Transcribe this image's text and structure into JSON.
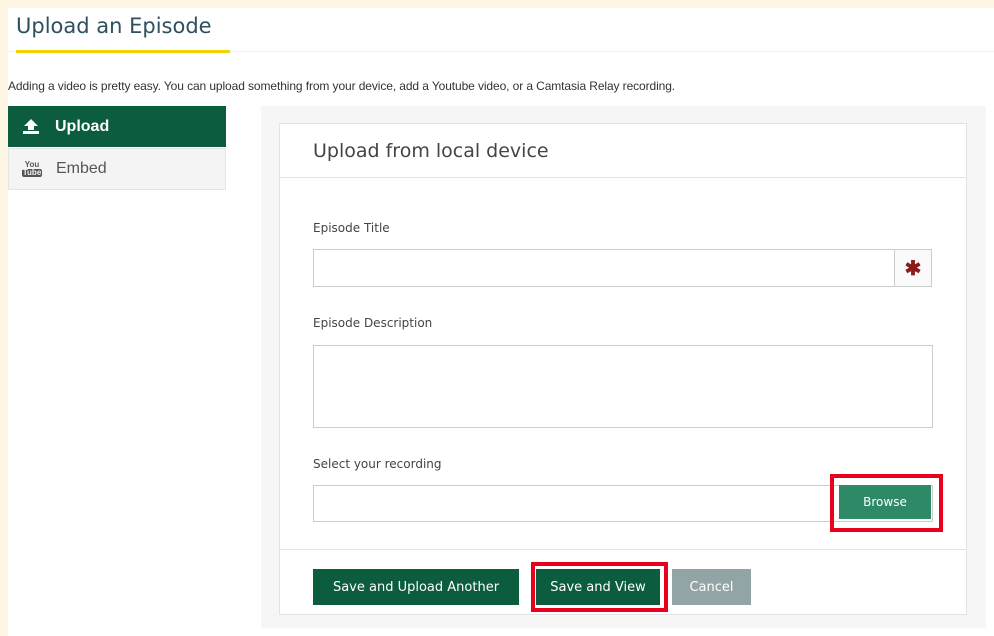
{
  "header": {
    "title": "Upload an Episode",
    "intro": "Adding a video is pretty easy. You can upload something from your device, add a Youtube video, or a Camtasia Relay recording."
  },
  "sidebar": {
    "items": [
      {
        "label": "Upload",
        "icon": "upload-icon",
        "active": true
      },
      {
        "label": "Embed",
        "icon": "youtube-icon",
        "active": false
      }
    ]
  },
  "panel": {
    "heading": "Upload from local device",
    "title_field": {
      "label": "Episode Title",
      "value": "",
      "required_marker": "✱"
    },
    "description_field": {
      "label": "Episode Description",
      "value": ""
    },
    "recording_field": {
      "label": "Select your recording",
      "value": "",
      "browse_label": "Browse"
    }
  },
  "footer": {
    "save_upload_another": "Save and Upload Another",
    "save_view": "Save and View",
    "cancel": "Cancel"
  },
  "colors": {
    "primary": "#0b5d3e",
    "browse": "#2e8a66",
    "cancel": "#93a4a6",
    "highlight": "#e8001c",
    "title_accent": "#f0d400"
  }
}
